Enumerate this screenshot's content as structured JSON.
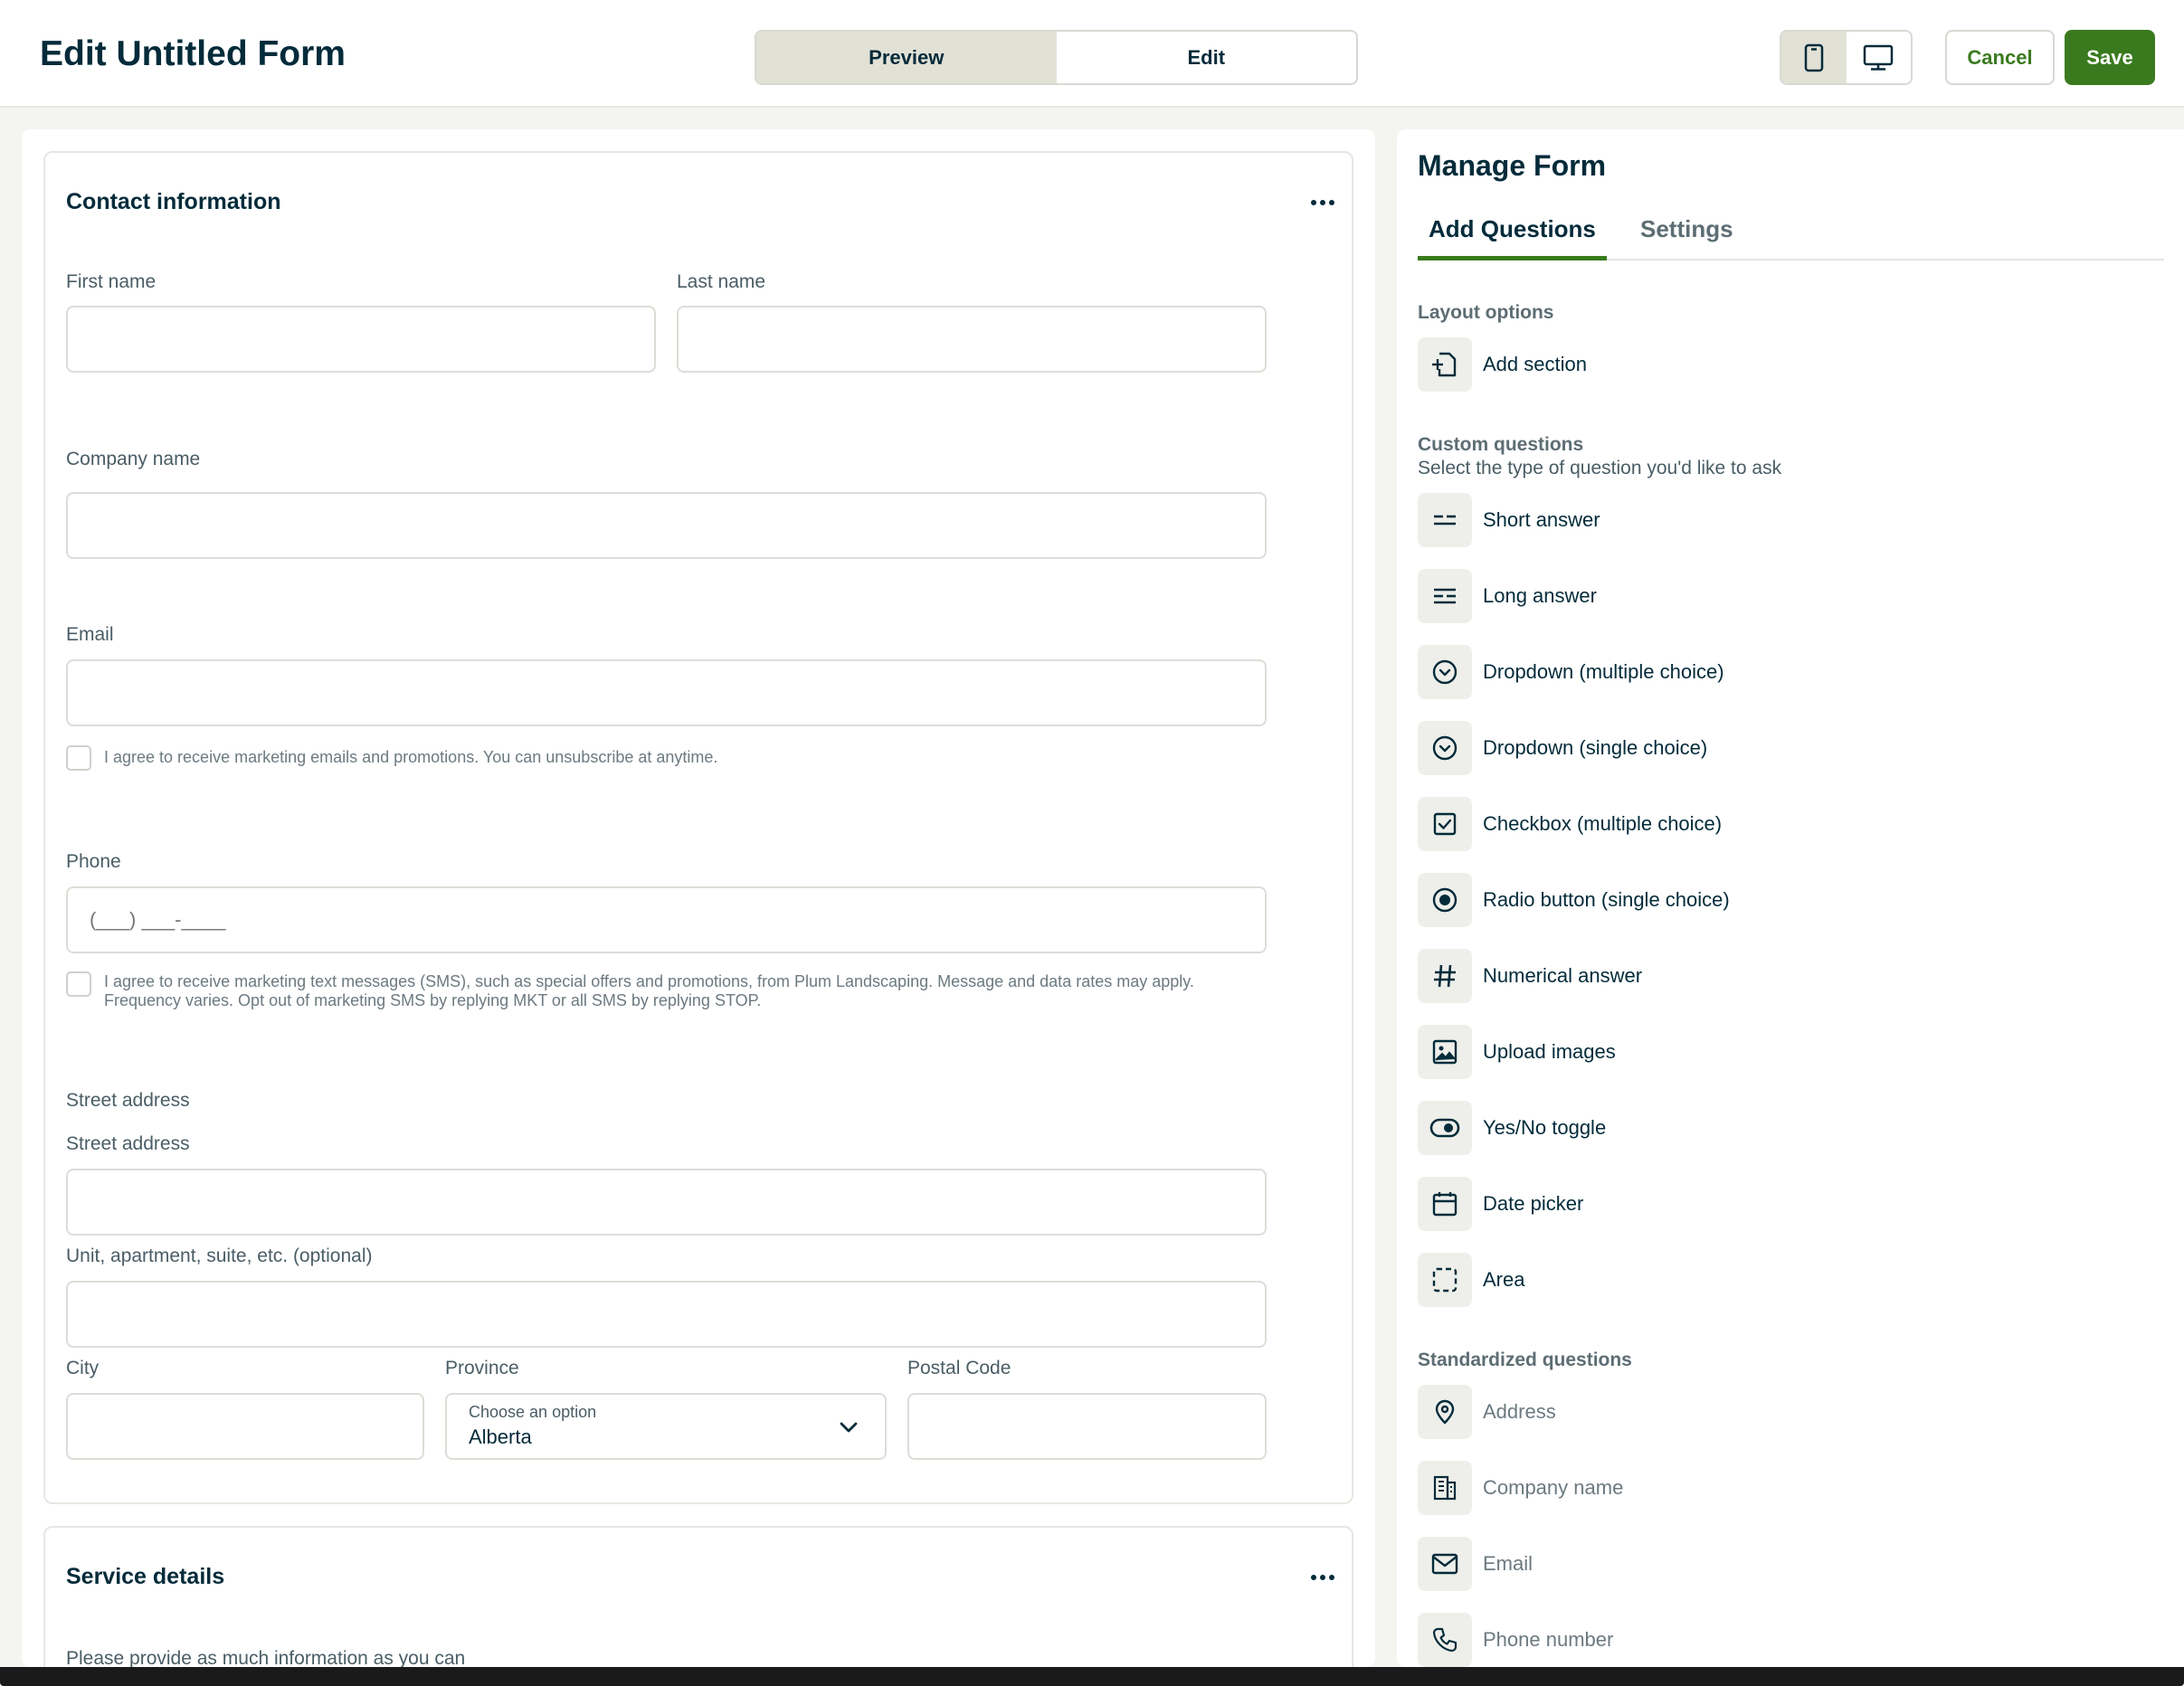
{
  "header": {
    "title": "Edit Untitled Form",
    "mode_tabs": {
      "preview": "Preview",
      "edit": "Edit",
      "active": "preview"
    },
    "device_active": "mobile",
    "cancel_label": "Cancel",
    "save_label": "Save"
  },
  "form": {
    "contact": {
      "title": "Contact information",
      "first_name_label": "First name",
      "last_name_label": "Last name",
      "company_label": "Company name",
      "email_label": "Email",
      "email_consent": "I agree to receive marketing emails and promotions. You can unsubscribe at anytime.",
      "phone_label": "Phone",
      "phone_placeholder": "(___) ___-____",
      "sms_consent": "I agree to receive marketing text messages (SMS), such as special offers and promotions, from Plum Landscaping. Message and data rates may apply. Frequency varies. Opt out of marketing SMS by replying MKT or all SMS by replying STOP.",
      "street_group_label": "Street address",
      "street_label": "Street address",
      "unit_label": "Unit, apartment, suite, etc. (optional)",
      "city_label": "City",
      "province_label": "Province",
      "province_placeholder": "Choose an option",
      "province_value": "Alberta",
      "postal_label": "Postal Code"
    },
    "service": {
      "title": "Service details",
      "intro": "Please provide as much information as you can"
    }
  },
  "panel": {
    "title": "Manage Form",
    "tabs": {
      "add_questions": "Add Questions",
      "settings": "Settings"
    },
    "layout_heading": "Layout options",
    "layout_items": [
      {
        "label": "Add section",
        "icon": "add-section-icon"
      }
    ],
    "custom_heading": "Custom questions",
    "custom_sub": "Select the type of question you'd like to ask",
    "custom_items": [
      {
        "label": "Short answer",
        "icon": "short-answer-icon"
      },
      {
        "label": "Long answer",
        "icon": "long-answer-icon"
      },
      {
        "label": "Dropdown (multiple choice)",
        "icon": "dropdown-icon"
      },
      {
        "label": "Dropdown (single choice)",
        "icon": "dropdown-icon"
      },
      {
        "label": "Checkbox (multiple choice)",
        "icon": "checkbox-icon"
      },
      {
        "label": "Radio button (single choice)",
        "icon": "radio-icon"
      },
      {
        "label": "Numerical answer",
        "icon": "hash-icon"
      },
      {
        "label": "Upload images",
        "icon": "image-icon"
      },
      {
        "label": "Yes/No toggle",
        "icon": "toggle-icon"
      },
      {
        "label": "Date picker",
        "icon": "calendar-icon"
      },
      {
        "label": "Area",
        "icon": "area-icon"
      }
    ],
    "standard_heading": "Standardized questions",
    "standard_items": [
      {
        "label": "Address",
        "icon": "map-pin-icon"
      },
      {
        "label": "Company name",
        "icon": "building-icon"
      },
      {
        "label": "Email",
        "icon": "envelope-icon"
      },
      {
        "label": "Phone number",
        "icon": "phone-icon"
      }
    ]
  },
  "colors": {
    "brand_green": "#3a7a1e",
    "text_dark": "#032b3a",
    "segment_active": "#e2e1d6"
  }
}
